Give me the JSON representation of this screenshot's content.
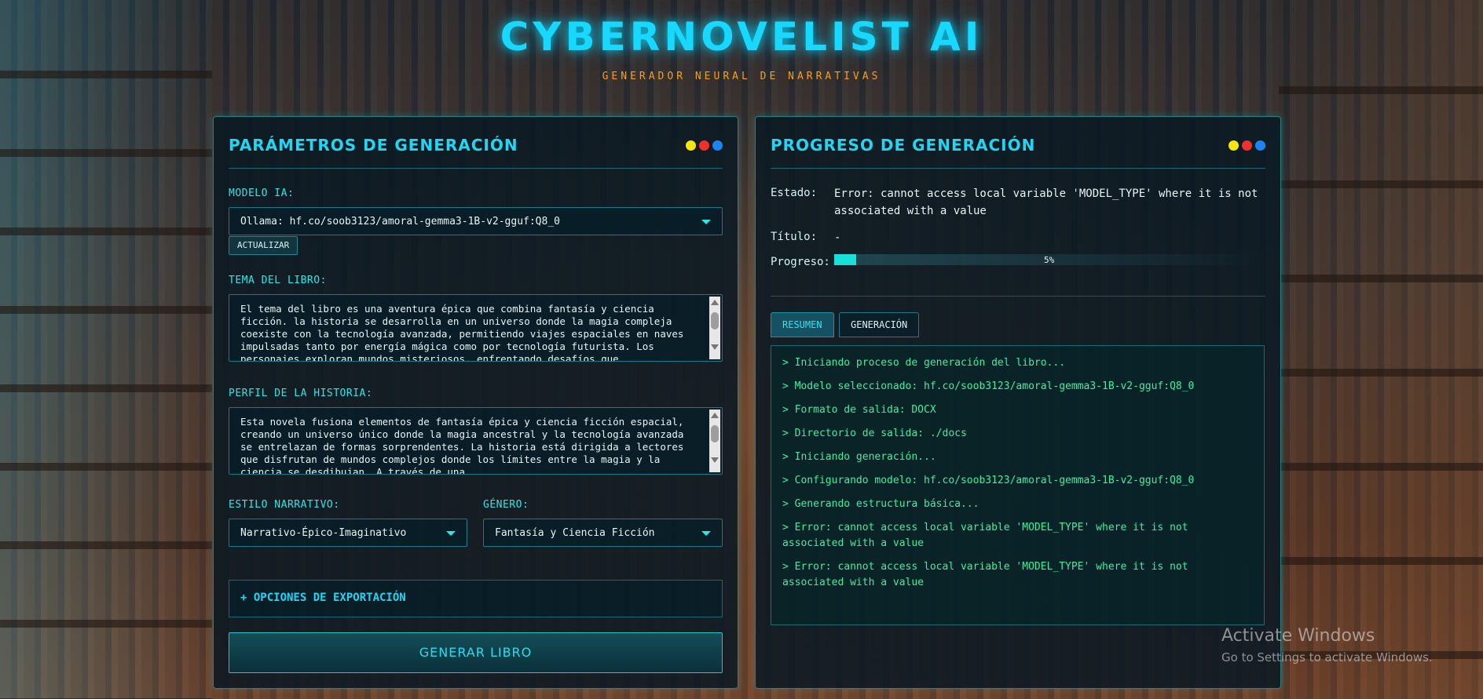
{
  "app": {
    "title": "CYBERNOVELIST AI",
    "subtitle": "GENERADOR NEURAL DE NARRATIVAS"
  },
  "colors": {
    "accent": "#20d6f2",
    "subtitle": "#f3a01c",
    "log_text": "#3df0a0",
    "dot_yellow": "#f5e60f",
    "dot_red": "#f0302a",
    "dot_blue": "#1a86f5"
  },
  "params_panel": {
    "title": "PARÁMETROS DE GENERACIÓN",
    "model_label": "MODELO IA:",
    "model_value": "Ollama: hf.co/soob3123/amoral-gemma3-1B-v2-gguf:Q8_0",
    "refresh_label": "ACTUALIZAR",
    "theme_label": "TEMA DEL LIBRO:",
    "theme_value": "El tema del libro es una aventura épica que combina fantasía y ciencia ficción. la historia se desarrolla en un universo donde la magia compleja coexiste con la tecnología avanzada, permitiendo viajes espaciales en naves impulsadas tanto por energía mágica como por tecnología futurista. Los personajes exploran mundos misteriosos, enfrentando desafíos que",
    "profile_label": "PERFIL DE LA HISTORIA:",
    "profile_value": "Esta novela fusiona elementos de fantasía épica y ciencia ficción espacial, creando un universo único donde la magia ancestral y la tecnología avanzada se entrelazan de formas sorprendentes. La historia está dirigida a lectores que disfrutan de mundos complejos donde los límites entre la magia y la ciencia se desdibujan. A través de una",
    "style_label": "ESTILO NARRATIVO:",
    "style_value": "Narrativo-Épico-Imaginativo",
    "genre_label": "GÉNERO:",
    "genre_value": "Fantasía y Ciencia Ficción",
    "export_label": "+ OPCIONES DE EXPORTACIÓN",
    "generate_label": "GENERAR LIBRO"
  },
  "progress_panel": {
    "title": "PROGRESO DE GENERACIÓN",
    "status_key": "Estado:",
    "status_value": "Error: cannot access local variable 'MODEL_TYPE' where it is not associated with a value",
    "title_key": "Título:",
    "title_value": "-",
    "progress_key": "Progreso:",
    "progress_text": "5%",
    "progress_fraction": 0.05,
    "tabs": [
      "RESUMEN",
      "GENERACIÓN"
    ],
    "active_tab": "RESUMEN",
    "log": [
      "> Iniciando proceso de generación del libro...",
      "> Modelo seleccionado: hf.co/soob3123/amoral-gemma3-1B-v2-gguf:Q8_0",
      "> Formato de salida: DOCX",
      "> Directorio de salida: ./docs",
      "> Iniciando generación...",
      "> Configurando modelo: hf.co/soob3123/amoral-gemma3-1B-v2-gguf:Q8_0",
      "> Generando estructura básica...",
      "> Error: cannot access local variable 'MODEL_TYPE' where it is not associated with a value",
      "> Error: cannot access local variable 'MODEL_TYPE' where it is not associated with a value"
    ]
  },
  "watermark": {
    "title": "Activate Windows",
    "subtitle": "Go to Settings to activate Windows."
  }
}
